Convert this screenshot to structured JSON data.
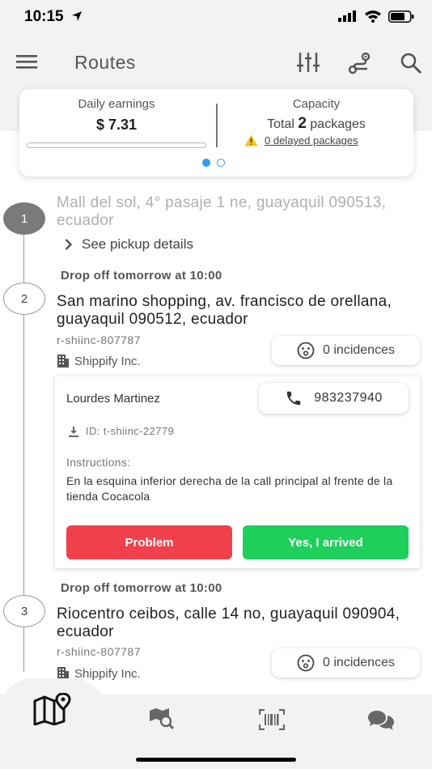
{
  "status_bar": {
    "time": "10:15"
  },
  "app_bar": {
    "title": "Routes"
  },
  "summary": {
    "earnings_label": "Daily earnings",
    "earnings_value": "$ 7.31",
    "earnings_progress": 0.0,
    "capacity_label": "Capacity",
    "capacity_prefix": "Total",
    "capacity_count": "2",
    "capacity_suffix": "packages",
    "delayed_label": "0 delayed packages"
  },
  "stops": [
    {
      "number": "1",
      "address": "Mall del sol, 4° pasaje 1 ne, guayaquil 090513, ecuador",
      "details_label": "See pickup details"
    },
    {
      "number": "2",
      "drop_title": "Drop off tomorrow at 10:00",
      "address": "San marino shopping, av. francisco de orellana, guayaquil 090512, ecuador",
      "ref": "r-shiinc-807787",
      "company": "Shippify Inc.",
      "incidences": "0 incidences",
      "contact_name": "Lourdes Martinez",
      "phone": "983237940",
      "package_id": "ID: t-shiinc-22779",
      "instructions_label": "Instructions:",
      "instructions_text": "En la esquina inferior derecha de la call principal al frente de la tienda Cocacola",
      "problem_label": "Problem",
      "arrived_label": "Yes, I arrived"
    },
    {
      "number": "3",
      "drop_title": "Drop off tomorrow at 10:00",
      "address": "Riocentro ceibos, calle 14 no, guayaquil 090904, ecuador",
      "ref": "r-shiinc-807787",
      "company": "Shippify Inc.",
      "incidences": "0 incidences"
    }
  ],
  "colors": {
    "accent": "#2e9bff",
    "problem": "#f0404c",
    "arrived": "#1ecf5c",
    "warning": "#f5c518"
  },
  "icons": [
    "menu-icon",
    "filter-icon",
    "route-icon",
    "search-icon",
    "warning-icon",
    "chevron-right-icon",
    "building-icon",
    "surprised-face-icon",
    "phone-icon",
    "download-icon",
    "map-icon",
    "map-search-icon",
    "barcode-icon",
    "chat-icon"
  ]
}
